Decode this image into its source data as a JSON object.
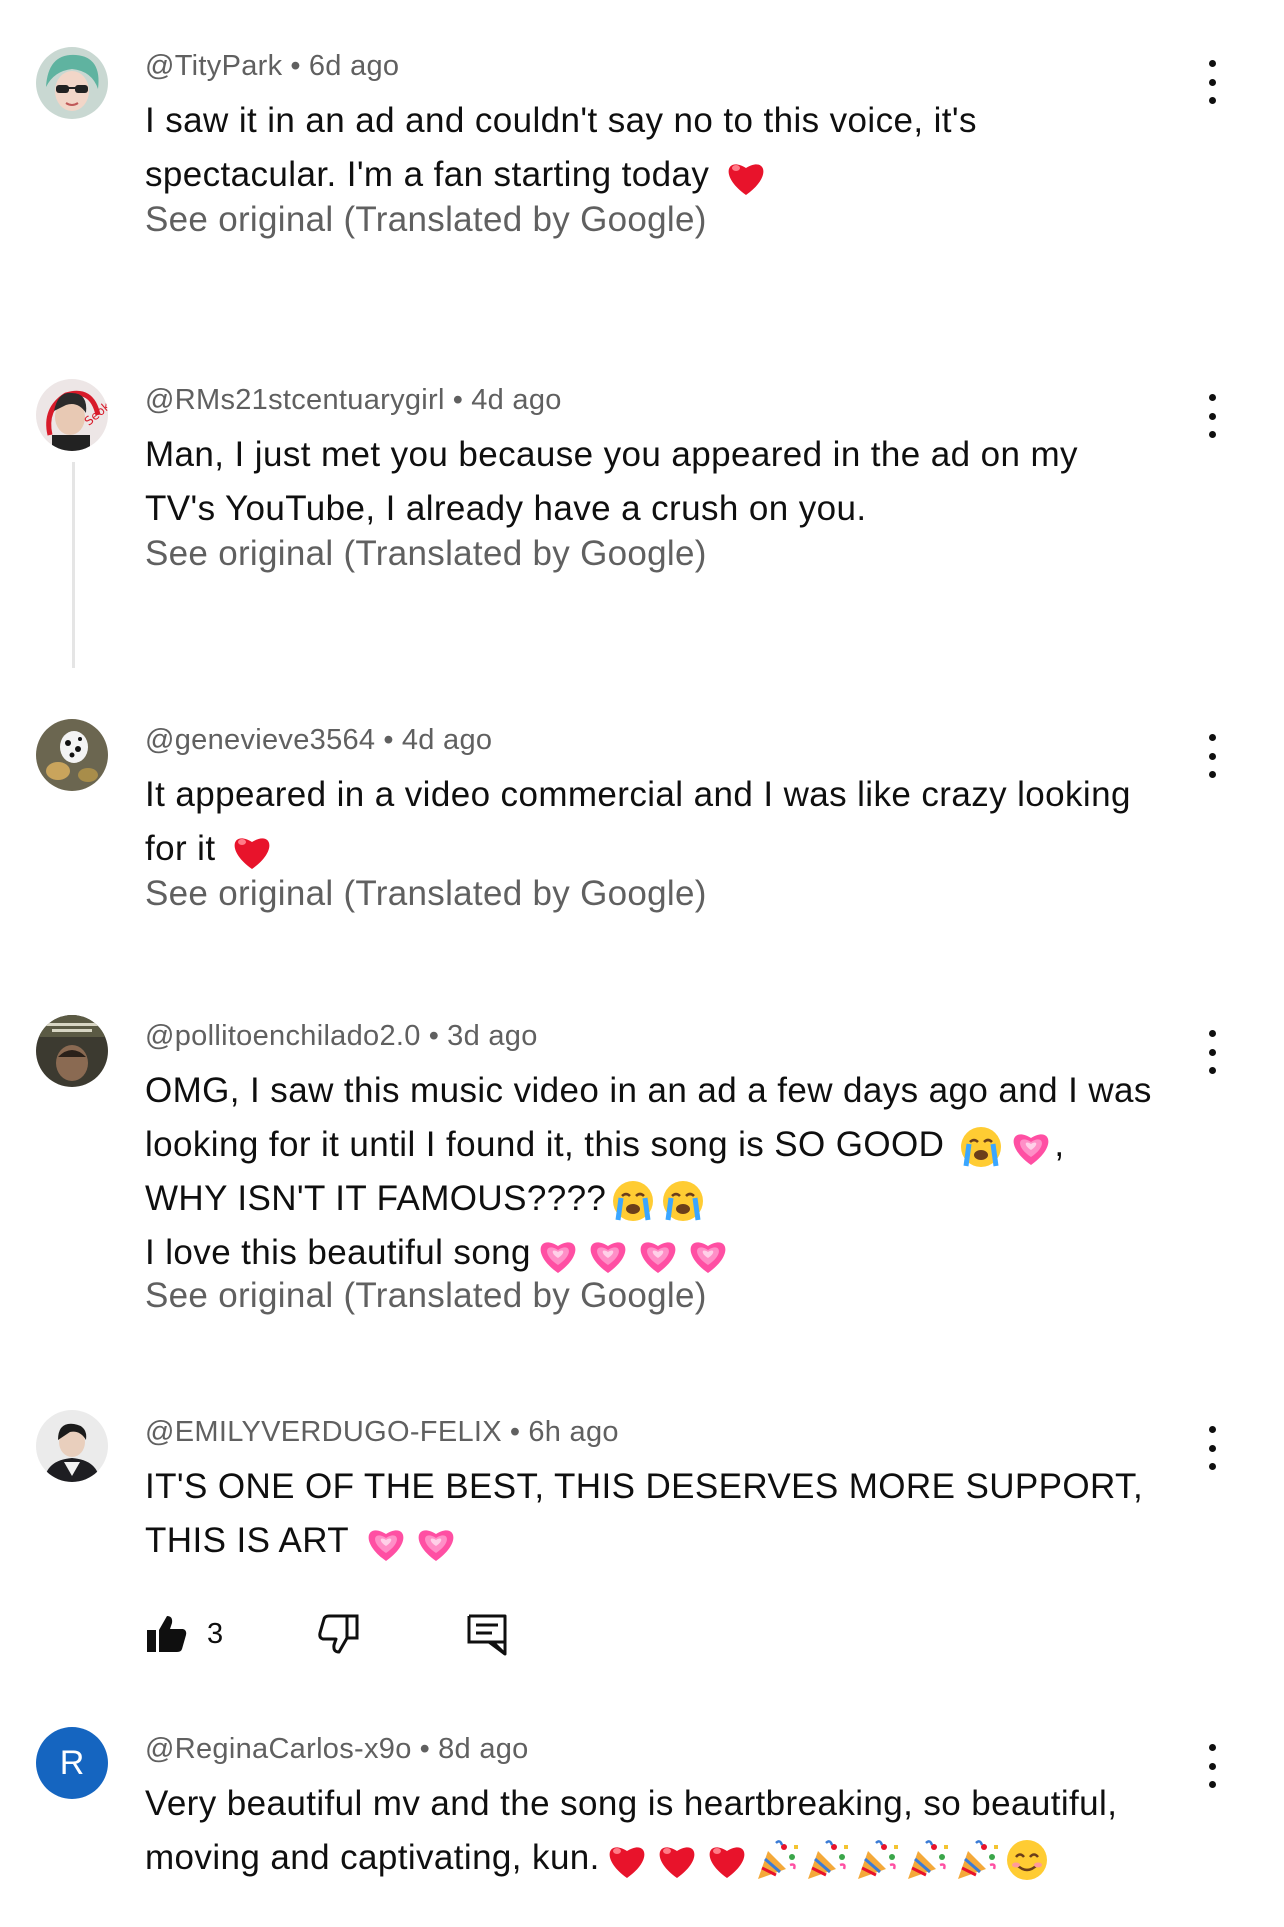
{
  "comments": [
    {
      "author": "@TityPark",
      "time": "6d ago",
      "lines": [
        "I saw it in an ad and couldn't say no to this voice, it's",
        "spectacular. I'm a fan starting today"
      ],
      "see_original": "See original (Translated by Google)"
    },
    {
      "author": "@RMs21stcentuarygirl",
      "time": "4d ago",
      "lines": [
        "Man, I just met you because you appeared in the ad on my",
        "TV's YouTube, I already have a crush on you."
      ],
      "see_original": "See original (Translated by Google)"
    },
    {
      "author": "@genevieve3564",
      "time": "4d ago",
      "lines": [
        "It appeared in a video commercial and I was like crazy looking",
        "for it"
      ],
      "see_original": "See original (Translated by Google)"
    },
    {
      "author": "@pollitoenchilado2.0",
      "time": "3d ago",
      "lines": [
        "OMG, I saw this music video in an ad a few days ago and I was",
        "looking for it until I found it, this song is SO GOOD",
        ",",
        "WHY ISN'T IT FAMOUS????",
        "I love this beautiful song"
      ],
      "see_original": "See original (Translated by Google)"
    },
    {
      "author": "@EMILYVERDUGO-FELIX",
      "time": "6h ago",
      "lines": [
        "IT'S ONE OF THE BEST, THIS DESERVES MORE SUPPORT,",
        "THIS IS ART"
      ],
      "like_count": "3"
    },
    {
      "author": "@ReginaCarlos-x9o",
      "time": "8d ago",
      "avatar_letter": "R",
      "lines": [
        "Very beautiful mv and the song is heartbreaking, so beautiful,",
        "moving and captivating, kun."
      ]
    }
  ],
  "icons": {
    "menu": "more-vert-icon",
    "like": "thumbs-up-filled-icon",
    "dislike": "thumbs-down-icon",
    "reply": "reply-comment-icon",
    "emoji_heart": "red-heart",
    "emoji_pink_heart": "growing-pink-heart",
    "emoji_cry": "loudly-crying-face",
    "emoji_party": "party-popper",
    "emoji_smile": "smiling-face"
  },
  "colors": {
    "text": "#0f0f0f",
    "meta": "#606060",
    "avatar_letter_bg": "#1565c0"
  }
}
